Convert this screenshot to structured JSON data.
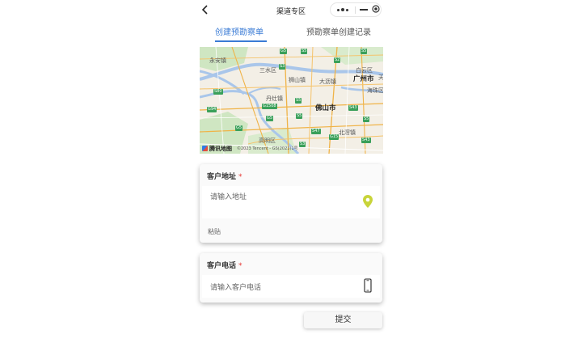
{
  "nav": {
    "title": "渠道专区",
    "back_icon": "chevron-left-icon",
    "capsule": {
      "more_icon": "more-dots-icon",
      "minimize_icon": "minimize-icon",
      "close_icon": "target-close-icon"
    }
  },
  "tabs": [
    {
      "label": "创建预勘察单",
      "active": true
    },
    {
      "label": "预勘察单创建记录",
      "active": false
    }
  ],
  "map": {
    "labels": [
      "永安镇",
      "三水区",
      "狮山镇",
      "大沥镇",
      "白云区",
      "广州市",
      "天",
      "海珠区",
      "丹灶镇",
      "佛山市",
      "北滘镇",
      "高明区"
    ],
    "city_labels": [
      "广州市",
      "佛山市"
    ],
    "road_badges": [
      "G5",
      "S5",
      "S2",
      "S3",
      "G94",
      "S80",
      "G1508",
      "S5",
      "G5",
      "S43",
      "S5",
      "S5",
      "G5",
      "S47",
      "S43",
      "G15",
      "S3",
      "S5"
    ],
    "provider": "腾讯地图",
    "copyright": "©2023 Tencent - GS(2023)1号",
    "colors": {
      "water": "#a9c6ea",
      "land": "#f3efe6",
      "green": "#cfe6c2",
      "highway": "#f0b347",
      "road": "#ffffff"
    }
  },
  "address_card": {
    "label": "客户地址",
    "required_mark": "*",
    "placeholder": "请输入地址",
    "paste_label": "粘贴",
    "pin_icon": "location-pin-icon",
    "pin_color": "#c8d43a"
  },
  "phone_card": {
    "label": "客户电话",
    "required_mark": "*",
    "placeholder": "请输入客户电话",
    "phone_icon": "mobile-phone-icon"
  },
  "submit_label": "提交",
  "colors": {
    "accent": "#3a7bd5",
    "required": "#e53935"
  }
}
